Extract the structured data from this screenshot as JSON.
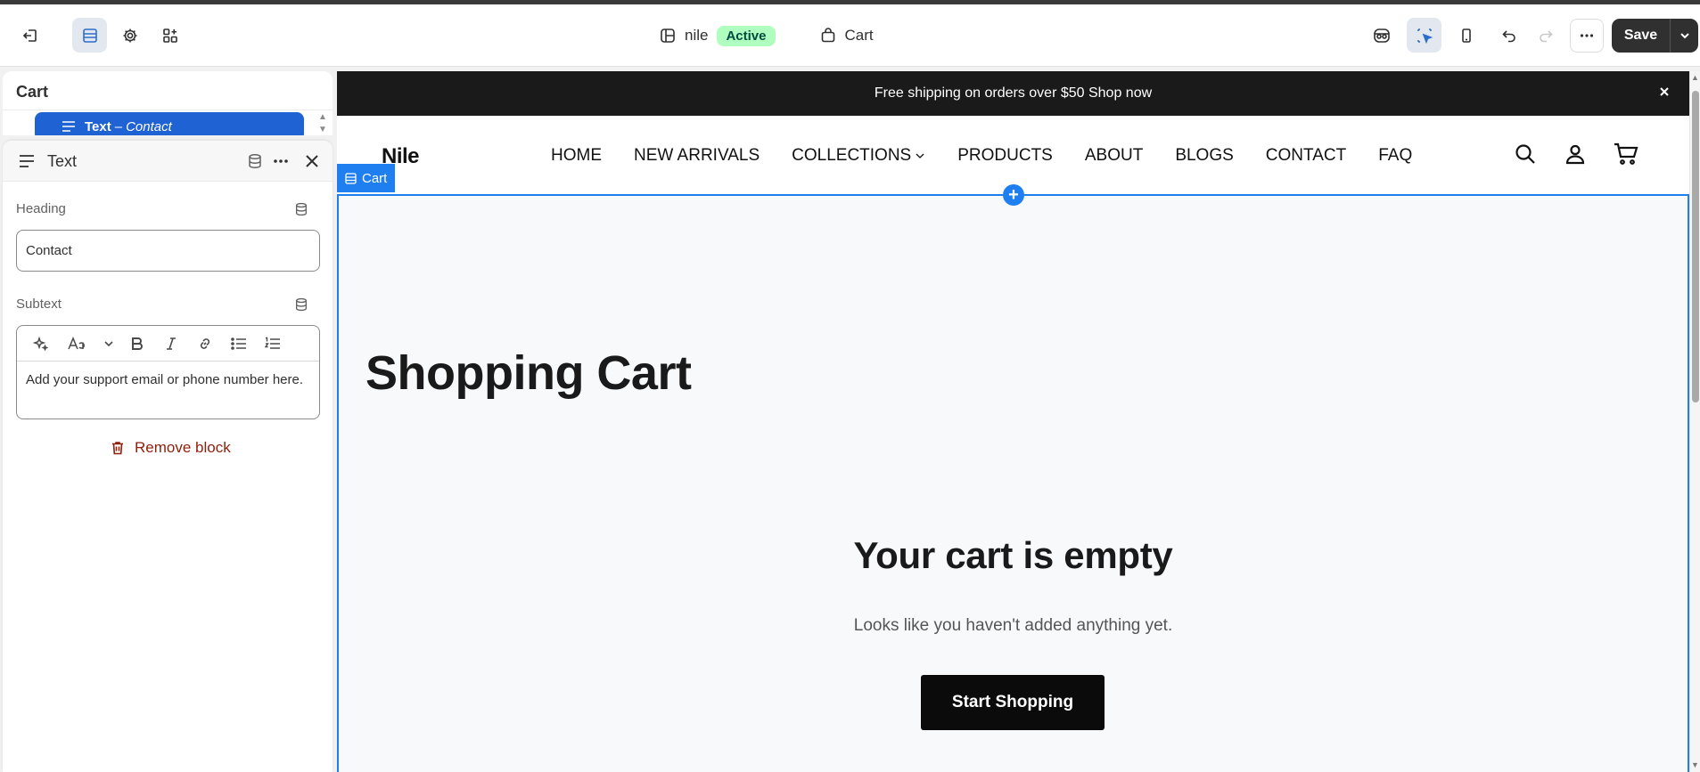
{
  "toolbar": {
    "store_name": "nile",
    "store_status": "Active",
    "template_name": "Cart",
    "save_label": "Save"
  },
  "sidebar": {
    "section_title": "Cart",
    "selected_block": {
      "type": "Text",
      "separator": "–",
      "name": "Contact"
    }
  },
  "block_panel": {
    "title": "Text",
    "heading_label": "Heading",
    "heading_value": "Contact",
    "subtext_label": "Subtext",
    "subtext_value": "Add your support email or phone number here.",
    "remove_label": "Remove block"
  },
  "preview": {
    "announcement": "Free shipping on orders over $50 Shop now",
    "logo": "Nile",
    "nav": [
      "HOME",
      "NEW ARRIVALS",
      "COLLECTIONS",
      "PRODUCTS",
      "ABOUT",
      "BLOGS",
      "CONTACT",
      "FAQ"
    ],
    "section_tag": "Cart",
    "page_title": "Shopping Cart",
    "empty_title": "Your cart is empty",
    "empty_subtitle": "Looks like you haven't added anything yet.",
    "cta_label": "Start Shopping"
  },
  "colors": {
    "accent": "#1f7ff0",
    "selected": "#1f62d3",
    "active_badge": "#affebf",
    "danger": "#8e1f0b"
  }
}
